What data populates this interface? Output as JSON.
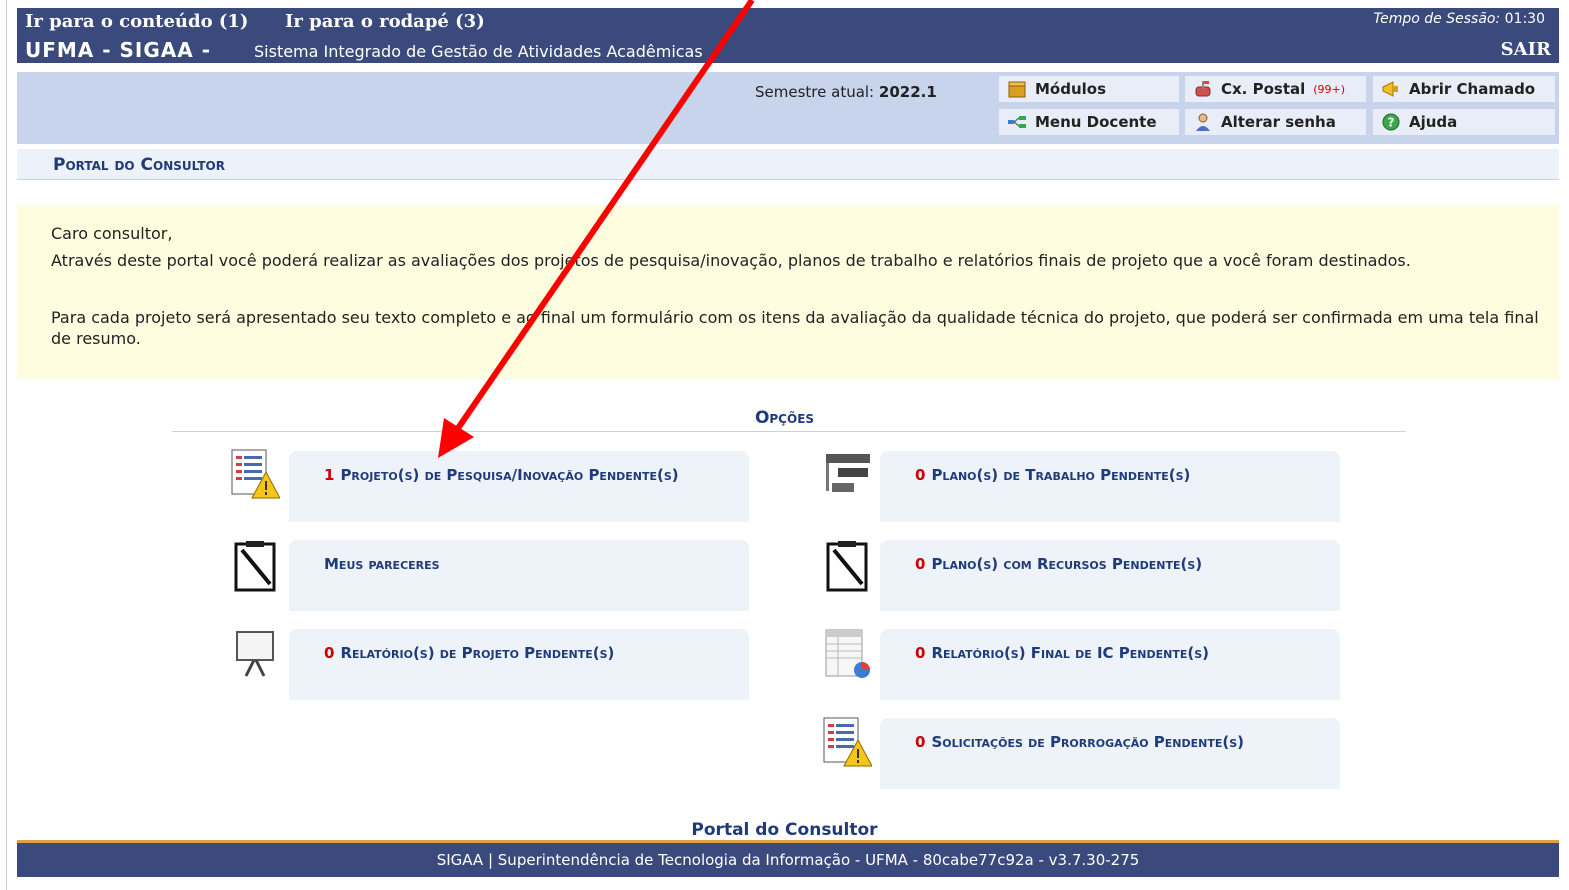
{
  "topbar": {
    "skip_content": "Ir para o conteúdo (1)",
    "skip_footer": "Ir para o rodapé (3)",
    "session_label": "Tempo de Sessão:",
    "session_time": "01:30",
    "brand": "UFMA - SIGAA -",
    "system_name": "Sistema Integrado de Gestão de Atividades Acadêmicas",
    "logout": "SAIR"
  },
  "infobar": {
    "semester_label": "Semestre atual:",
    "semester_value": "2022.1",
    "buttons": {
      "modulos": "Módulos",
      "cx_postal": "Cx. Postal",
      "cx_postal_badge": "(99+)",
      "abrir_chamado": "Abrir Chamado",
      "menu_docente": "Menu Docente",
      "alterar_senha": "Alterar senha",
      "ajuda": "Ajuda"
    }
  },
  "portal": {
    "title": "Portal do Consultor"
  },
  "notice": {
    "greeting": "Caro consultor,",
    "paragraph1": "Através deste portal você poderá realizar as avaliações dos projetos de pesquisa/inovação, planos de trabalho e relatórios finais de projeto que a você foram destinados.",
    "paragraph2": "Para cada projeto será apresentado seu texto completo e ao final um formulário com os itens da avaliação da qualidade técnica do projeto, que poderá ser confirmada em uma tela final de resumo."
  },
  "options": {
    "title": "Opções",
    "projetos": {
      "count": "1",
      "label": "Projeto(s) de Pesquisa/Inovação Pendente(s)"
    },
    "planos_trabalho": {
      "count": "0",
      "label": "Plano(s) de Trabalho Pendente(s)"
    },
    "meus_pareceres": {
      "label": "Meus pareceres"
    },
    "planos_recursos": {
      "count": "0",
      "label": "Plano(s) com Recursos Pendente(s)"
    },
    "relatorios_projeto": {
      "count": "0",
      "label": "Relatório(s) de Projeto Pendente(s)"
    },
    "relatorio_final_ic": {
      "count": "0",
      "label": "Relatório(s) Final de IC Pendente(s)"
    },
    "prorrogacao": {
      "count": "0",
      "label": "Solicitações de Prorrogação Pendente(s)"
    }
  },
  "footer": {
    "portal_title": "Portal do Consultor",
    "text": "SIGAA | Superintendência de Tecnologia da Informação - UFMA - 80cabe77c92a - v3.7.30-275"
  },
  "colors": {
    "header_bg": "#3a4a7c",
    "info_bg": "#c8d4ec",
    "link": "#1f3b7a",
    "count_red": "#cc0000",
    "notice_bg": "#fffde0",
    "arrow": "#ff0000"
  }
}
